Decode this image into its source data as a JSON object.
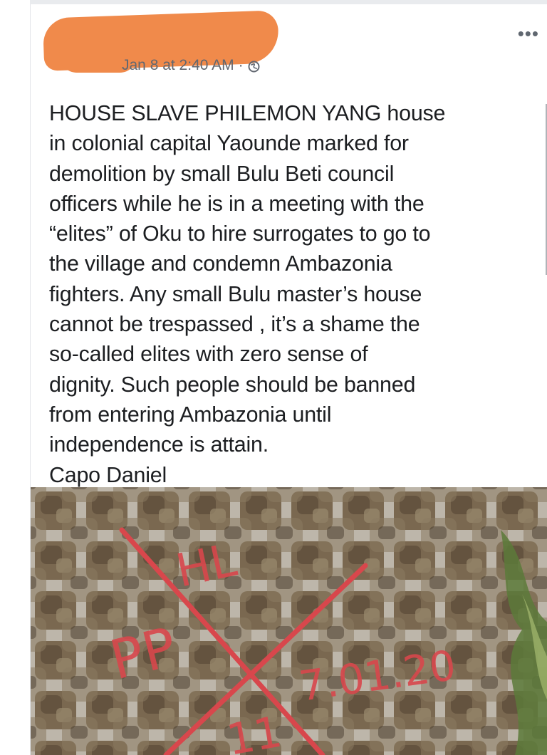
{
  "post": {
    "author_name": "",
    "timestamp": "Jan 8 at 2:40 AM",
    "separator": "·",
    "privacy_icon": "globe-icon",
    "more_label": "•••",
    "body": "HOUSE SLAVE PHILEMON YANG house\nin colonial capital Yaounde marked for\ndemolition by small Bulu Beti council\nofficers while he is in a meeting with the\n“elites” of Oku to hire surrogates to go to\nthe village and condemn Ambazonia\nfighters. Any small Bulu master’s house\ncannot be trespassed , it’s a shame the\nso-called elites with zero sense of\ndignity. Such people should be banned\nfrom entering Ambazonia until\nindependence is attain.",
    "signature": "Capo Daniel",
    "photo": {
      "graffiti_lines": [
        "HL",
        "PP",
        "7.01.20",
        "11"
      ],
      "graffiti_color": "#d8474c"
    }
  },
  "colors": {
    "redaction": "#f08a4b",
    "text": "#1c1e21",
    "meta": "#616770"
  }
}
